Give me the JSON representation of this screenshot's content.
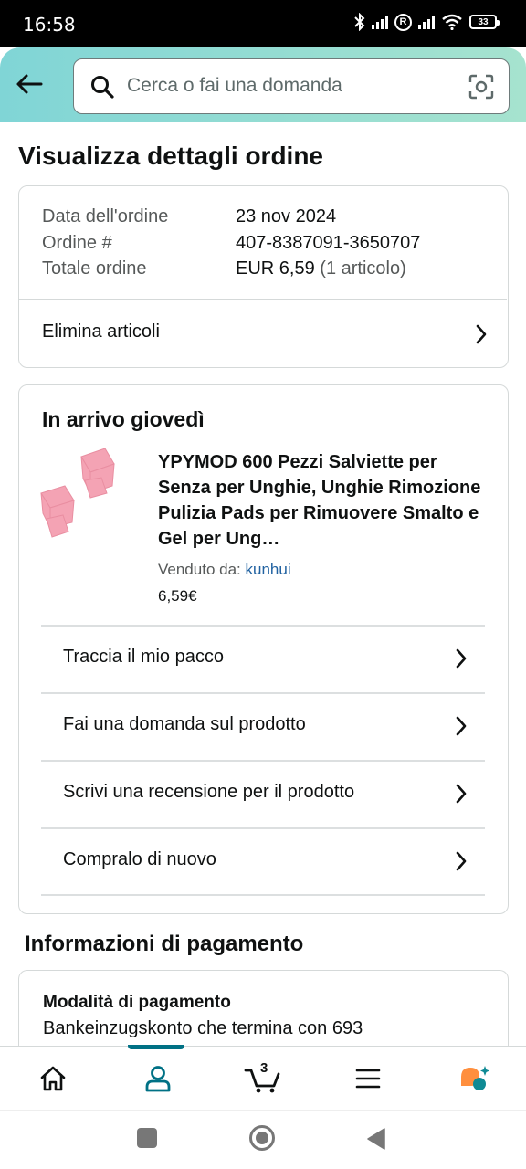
{
  "status_bar": {
    "time": "16:58",
    "battery": "33"
  },
  "header": {
    "search_placeholder": "Cerca o fai una domanda"
  },
  "page_title": "Visualizza dettagli ordine",
  "order_summary": {
    "rows": [
      {
        "label": "Data dell'ordine",
        "value": "23 nov 2024"
      },
      {
        "label": "Ordine #",
        "value": "407-8387091-3650707"
      },
      {
        "label": "Totale ordine",
        "value": "EUR 6,59",
        "value_extra": "(1 articolo)"
      }
    ],
    "delete_items": "Elimina articoli"
  },
  "shipment": {
    "title": "In arrivo giovedì",
    "product": {
      "title": "YPYMOD 600 Pezzi Salviette per Senza per Unghie, Unghie Rimozione Pulizia Pads per Rimuovere Smalto e Gel per Ung…",
      "seller_label": "Venduto da:",
      "seller_name": "kunhui",
      "price": "6,59€",
      "thumb_color": "#f4a3b4"
    },
    "actions": [
      "Traccia il mio pacco",
      "Fai una domanda sul prodotto",
      "Scrivi una recensione per il prodotto",
      "Compralo di nuovo"
    ]
  },
  "payment": {
    "title": "Informazioni di pagamento",
    "method_label": "Modalità di pagamento",
    "method_value": "Bankeinzugskonto che termina con 693"
  },
  "bottom_nav": {
    "items": [
      "home-icon",
      "account-icon",
      "cart-icon",
      "menu-icon",
      "rufus-icon"
    ],
    "cart_count": "3",
    "active": "account-icon",
    "accent_color": "#007185"
  },
  "colors": {
    "header_gradient_start": "#80d5d6",
    "header_gradient_end": "#a6e3cf",
    "link": "#2162a1",
    "rufus_orange": "#ff8f3e",
    "rufus_teal": "#0f8a94"
  }
}
